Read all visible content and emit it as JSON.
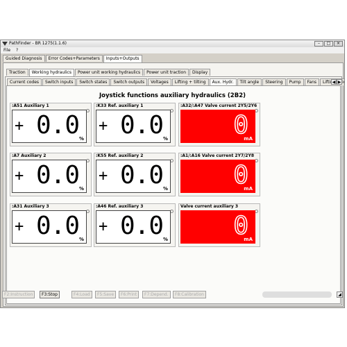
{
  "window": {
    "title": "PathFinder - BR 1275(1.1.6)",
    "app_icon": "pathfinder-logo-icon",
    "min_icon": "minimize-icon",
    "max_icon": "maximize-icon",
    "close_icon": "close-icon"
  },
  "menu": {
    "file": "File",
    "help": "?"
  },
  "main_tabs": [
    {
      "label": "Guided Diagnosis",
      "active": false
    },
    {
      "label": "Error Codes+Parameters",
      "active": false
    },
    {
      "label": "Inputs+Outputs",
      "active": true
    }
  ],
  "sub_tabs": [
    {
      "label": "Traction",
      "active": false
    },
    {
      "label": "Working hydraulics",
      "active": true
    },
    {
      "label": "Power unit working hydraulics",
      "active": false
    },
    {
      "label": "Power unit traction",
      "active": false
    },
    {
      "label": "Display",
      "active": false
    }
  ],
  "detail_tabs": [
    {
      "label": "Current codes",
      "active": false
    },
    {
      "label": "Switch inputs",
      "active": false
    },
    {
      "label": "Switch states",
      "active": false
    },
    {
      "label": "Switch outputs",
      "active": false
    },
    {
      "label": "Voltages",
      "active": false
    },
    {
      "label": "Lifting + tilting",
      "active": false
    },
    {
      "label": "Aux. Hydr.",
      "active": true
    },
    {
      "label": "Tilt angle",
      "active": false
    },
    {
      "label": "Steering",
      "active": false
    },
    {
      "label": "Pump",
      "active": false
    },
    {
      "label": "Fans",
      "active": false
    },
    {
      "label": "Lifting height",
      "active": false
    }
  ],
  "scroll": {
    "left": "◀",
    "right": "▶"
  },
  "heading": "Joystick functions auxiliary hydraulics (2B2)",
  "gauges": [
    {
      "label": ":A51 Auxiliary 1",
      "sign": "+",
      "value": "0.0",
      "unit": "%",
      "style": "white"
    },
    {
      "label": ":K33 Ref. auxiliary 1",
      "sign": "+",
      "value": "0.0",
      "unit": "%",
      "style": "white"
    },
    {
      "label": ":A32/:A47 Valve current 2Y5/2Y6",
      "sign": "",
      "value": "0",
      "unit": "mA",
      "style": "red"
    },
    {
      "label": ":A7 Auxiliary 2",
      "sign": "+",
      "value": "0.0",
      "unit": "%",
      "style": "white"
    },
    {
      "label": ":K55 Ref. auxiliary 2",
      "sign": "+",
      "value": "0.0",
      "unit": "%",
      "style": "white"
    },
    {
      "label": ":A1/:A16 Valve current 2Y7/2Y8",
      "sign": "",
      "value": "0",
      "unit": "mA",
      "style": "red"
    },
    {
      "label": ":A31 Auxiliary 3",
      "sign": "+",
      "value": "0.0",
      "unit": "%",
      "style": "white"
    },
    {
      "label": ":A46 Ref. auxiliary 3",
      "sign": "+",
      "value": "0.0",
      "unit": "%",
      "style": "white"
    },
    {
      "label": "Valve current auxiliary 3",
      "sign": "",
      "value": "0",
      "unit": "mA",
      "style": "red"
    }
  ],
  "function_buttons": [
    {
      "label": "F2:Instruction",
      "enabled": false
    },
    {
      "label": "F3:Stop",
      "enabled": true
    },
    {
      "label": "F4:Load",
      "enabled": false
    },
    {
      "label": "F5:Save",
      "enabled": false
    },
    {
      "label": "F6:Print",
      "enabled": false
    },
    {
      "label": "F7:Depend.",
      "enabled": false
    },
    {
      "label": "F8:Calibration",
      "enabled": false
    }
  ],
  "colors": {
    "window_bg": "#d4d0c8",
    "panel_bg": "#f5f4f0",
    "alarm_red": "#ff0000"
  }
}
